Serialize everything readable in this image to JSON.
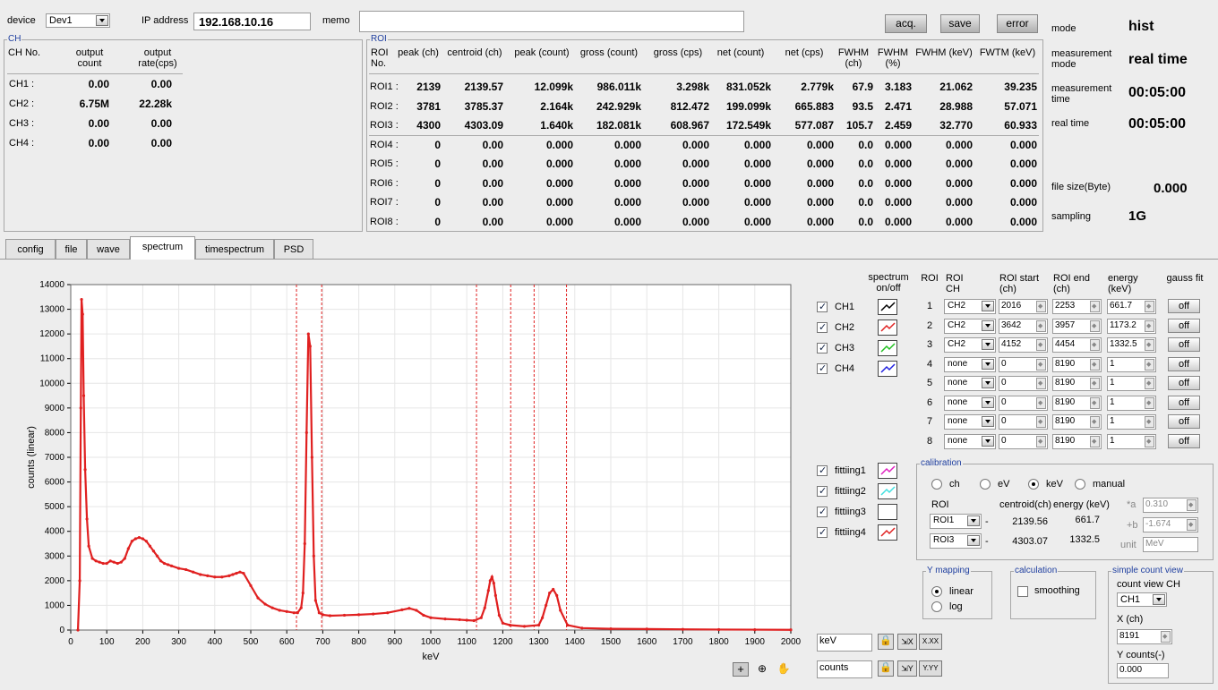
{
  "top": {
    "device_label": "device",
    "device_value": "Dev1",
    "ip_label": "IP address",
    "ip_value": "192.168.10.16",
    "memo_label": "memo",
    "memo_value": "",
    "buttons": {
      "acq": "acq.",
      "save": "save",
      "error": "error"
    }
  },
  "status": {
    "mode_label": "mode",
    "mode_value": "hist",
    "mmode_label": "measurement mode",
    "mmode_value": "real time",
    "mtime_label": "measurement time",
    "mtime_value": "00:05:00",
    "rtime_label": "real time",
    "rtime_value": "00:05:00",
    "fsize_label": "file size(Byte)",
    "fsize_value": "0.000",
    "sampling_label": "sampling",
    "sampling_value": "1G"
  },
  "ch_panel": {
    "title": "CH",
    "headers": [
      "CH No.",
      "output count",
      "output rate(cps)"
    ],
    "rows": [
      {
        "ch": "CH1 :",
        "count": "0.00",
        "rate": "0.00"
      },
      {
        "ch": "CH2 :",
        "count": "6.75M",
        "rate": "22.28k"
      },
      {
        "ch": "CH3 :",
        "count": "0.00",
        "rate": "0.00"
      },
      {
        "ch": "CH4 :",
        "count": "0.00",
        "rate": "0.00"
      }
    ]
  },
  "roi_panel": {
    "title": "ROI",
    "headers": [
      "ROI No.",
      "peak (ch)",
      "centroid (ch)",
      "peak (count)",
      "gross (count)",
      "gross (cps)",
      "net (count)",
      "net (cps)",
      "FWHM (ch)",
      "FWHM (%)",
      "FWHM (keV)",
      "FWTM (keV)"
    ],
    "rows": [
      [
        "ROI1 :",
        "2139",
        "2139.57",
        "12.099k",
        "986.011k",
        "3.298k",
        "831.052k",
        "2.779k",
        "67.9",
        "3.183",
        "21.062",
        "39.235"
      ],
      [
        "ROI2 :",
        "3781",
        "3785.37",
        "2.164k",
        "242.929k",
        "812.472",
        "199.099k",
        "665.883",
        "93.5",
        "2.471",
        "28.988",
        "57.071"
      ],
      [
        "ROI3 :",
        "4300",
        "4303.09",
        "1.640k",
        "182.081k",
        "608.967",
        "172.549k",
        "577.087",
        "105.7",
        "2.459",
        "32.770",
        "60.933"
      ],
      [
        "ROI4 :",
        "0",
        "0.00",
        "0.000",
        "0.000",
        "0.000",
        "0.000",
        "0.000",
        "0.0",
        "0.000",
        "0.000",
        "0.000"
      ],
      [
        "ROI5 :",
        "0",
        "0.00",
        "0.000",
        "0.000",
        "0.000",
        "0.000",
        "0.000",
        "0.0",
        "0.000",
        "0.000",
        "0.000"
      ],
      [
        "ROI6 :",
        "0",
        "0.00",
        "0.000",
        "0.000",
        "0.000",
        "0.000",
        "0.000",
        "0.0",
        "0.000",
        "0.000",
        "0.000"
      ],
      [
        "ROI7 :",
        "0",
        "0.00",
        "0.000",
        "0.000",
        "0.000",
        "0.000",
        "0.000",
        "0.0",
        "0.000",
        "0.000",
        "0.000"
      ],
      [
        "ROI8 :",
        "0",
        "0.00",
        "0.000",
        "0.000",
        "0.000",
        "0.000",
        "0.000",
        "0.0",
        "0.000",
        "0.000",
        "0.000"
      ]
    ]
  },
  "tabs": [
    "config",
    "file",
    "wave",
    "spectrum",
    "timespectrum",
    "PSD"
  ],
  "active_tab": "spectrum",
  "chart_data": {
    "type": "line",
    "title": "",
    "xlabel": "keV",
    "ylabel": "counts (linear)",
    "xlim": [
      0,
      2000
    ],
    "ylim": [
      0,
      14000
    ],
    "xticks": [
      0,
      100,
      200,
      300,
      400,
      500,
      600,
      700,
      800,
      900,
      1000,
      1100,
      1200,
      1300,
      1400,
      1500,
      1600,
      1700,
      1800,
      1900,
      2000
    ],
    "yticks": [
      0,
      1000,
      2000,
      3000,
      4000,
      5000,
      6000,
      7000,
      8000,
      9000,
      10000,
      11000,
      12000,
      13000,
      14000
    ],
    "grid": true,
    "series": [
      {
        "color": "#e02020",
        "x": [
          20,
          25,
          28,
          30,
          33,
          36,
          40,
          45,
          50,
          60,
          70,
          80,
          90,
          100,
          110,
          120,
          130,
          140,
          150,
          160,
          170,
          180,
          190,
          200,
          210,
          220,
          230,
          240,
          250,
          260,
          270,
          280,
          300,
          320,
          340,
          360,
          380,
          400,
          420,
          440,
          450,
          460,
          470,
          480,
          500,
          520,
          540,
          560,
          580,
          600,
          620,
          630,
          640,
          645,
          650,
          655,
          660,
          665,
          670,
          675,
          680,
          690,
          700,
          720,
          760,
          800,
          840,
          880,
          920,
          940,
          960,
          980,
          1000,
          1040,
          1080,
          1100,
          1120,
          1140,
          1150,
          1160,
          1165,
          1170,
          1175,
          1180,
          1190,
          1200,
          1220,
          1260,
          1300,
          1310,
          1320,
          1330,
          1340,
          1350,
          1360,
          1380,
          1420,
          1500,
          1600,
          1700,
          1800,
          1900,
          2000
        ],
        "y": [
          0,
          2000,
          9000,
          13400,
          12800,
          9500,
          6500,
          4500,
          3400,
          2900,
          2800,
          2750,
          2700,
          2700,
          2800,
          2750,
          2700,
          2750,
          2900,
          3300,
          3600,
          3700,
          3750,
          3700,
          3600,
          3400,
          3200,
          3000,
          2800,
          2700,
          2650,
          2600,
          2500,
          2450,
          2350,
          2250,
          2200,
          2150,
          2150,
          2200,
          2250,
          2300,
          2350,
          2300,
          1800,
          1300,
          1050,
          900,
          800,
          750,
          700,
          700,
          900,
          1500,
          3500,
          8000,
          12000,
          11500,
          7000,
          3000,
          1200,
          700,
          620,
          580,
          600,
          620,
          650,
          700,
          820,
          880,
          800,
          600,
          500,
          450,
          420,
          400,
          380,
          500,
          900,
          1600,
          2000,
          2150,
          1900,
          1400,
          600,
          280,
          200,
          150,
          200,
          500,
          1000,
          1500,
          1650,
          1400,
          800,
          200,
          80,
          50,
          40,
          30,
          20,
          15,
          10
        ]
      }
    ],
    "roi_markers": [
      627,
      697,
      1127,
      1222,
      1287,
      1377
    ]
  },
  "right_panel": {
    "spectrum_header": "spectrum on/off",
    "channels": [
      {
        "label": "CH1",
        "on": true,
        "color": "#000000"
      },
      {
        "label": "CH2",
        "on": true,
        "color": "#e02020"
      },
      {
        "label": "CH3",
        "on": true,
        "color": "#20c020"
      },
      {
        "label": "CH4",
        "on": true,
        "color": "#2020e0"
      }
    ],
    "fittings": [
      {
        "label": "fittiing1",
        "on": true,
        "color": "#e020c0"
      },
      {
        "label": "fittiing2",
        "on": true,
        "color": "#40e0e0"
      },
      {
        "label": "fittiing3",
        "on": true,
        "color": "#ffffff"
      },
      {
        "label": "fittiing4",
        "on": true,
        "color": "#e02020"
      }
    ],
    "roi_headers": [
      "ROI",
      "ROI CH",
      "ROI start (ch)",
      "ROI end (ch)",
      "energy (keV)",
      "gauss fit"
    ],
    "roi_rows": [
      {
        "n": "1",
        "ch": "CH2",
        "start": "2016",
        "end": "2253",
        "energy": "661.7",
        "fit": "off"
      },
      {
        "n": "2",
        "ch": "CH2",
        "start": "3642",
        "end": "3957",
        "energy": "1173.2",
        "fit": "off"
      },
      {
        "n": "3",
        "ch": "CH2",
        "start": "4152",
        "end": "4454",
        "energy": "1332.5",
        "fit": "off"
      },
      {
        "n": "4",
        "ch": "none",
        "start": "0",
        "end": "8190",
        "energy": "1",
        "fit": "off"
      },
      {
        "n": "5",
        "ch": "none",
        "start": "0",
        "end": "8190",
        "energy": "1",
        "fit": "off"
      },
      {
        "n": "6",
        "ch": "none",
        "start": "0",
        "end": "8190",
        "energy": "1",
        "fit": "off"
      },
      {
        "n": "7",
        "ch": "none",
        "start": "0",
        "end": "8190",
        "energy": "1",
        "fit": "off"
      },
      {
        "n": "8",
        "ch": "none",
        "start": "0",
        "end": "8190",
        "energy": "1",
        "fit": "off"
      }
    ],
    "calibration": {
      "title": "calibration",
      "options": [
        "ch",
        "eV",
        "keV",
        "manual"
      ],
      "selected": "keV",
      "roi_label": "ROI",
      "centroid_label": "centroid(ch)",
      "energy_label": "energy (keV)",
      "rows": [
        {
          "roi": "ROI1",
          "centroid": "2139.56",
          "energy": "661.7"
        },
        {
          "roi": "ROI3",
          "centroid": "4303.07",
          "energy": "1332.5"
        }
      ],
      "a_label": "*a",
      "a_value": "0.310",
      "b_label": "+b",
      "b_value": "-1.674",
      "unit_label": "unit",
      "unit_value": "MeV"
    },
    "ymapping": {
      "title": "Y mapping",
      "options": [
        "linear",
        "log"
      ],
      "selected": "linear"
    },
    "calculation": {
      "title": "calculation",
      "smoothing_label": "smoothing"
    },
    "simple_count": {
      "title": "simple count view",
      "ch_label": "count view CH",
      "ch_value": "CH1",
      "x_label": "X (ch)",
      "x_value": "8191",
      "y_label": "Y counts(-)",
      "y_value": "0.000"
    },
    "axis_controls": {
      "x_name": "keV",
      "y_name": "counts",
      "x_fmt": "X.XX",
      "y_fmt": "Y.YY"
    }
  }
}
